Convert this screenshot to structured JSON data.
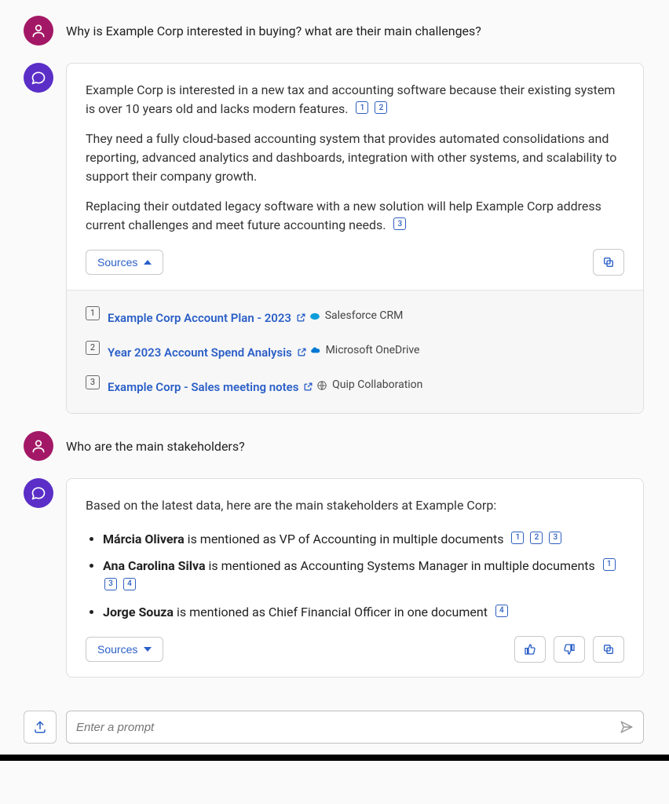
{
  "messages": [
    {
      "role": "user",
      "text": "Why is Example Corp interested in buying? what are their main challenges?"
    },
    {
      "role": "bot",
      "paragraphs": {
        "p1": "Example Corp is interested in a new tax and accounting software because their existing system is over 10 years old and lacks modern features.",
        "p2": "They need a fully cloud-based accounting system that provides automated consolidations and reporting, advanced analytics and dashboards, integration with other systems, and scalability to support their company growth.",
        "p3": "Replacing their outdated legacy software with a new solution will help Example Corp address current challenges and meet future accounting needs."
      },
      "citations": {
        "c1": "1",
        "c2": "2",
        "c3": "3"
      },
      "sources_label": "Sources",
      "sources_expanded": true,
      "sources": [
        {
          "num": "1",
          "title": "Example Corp Account Plan - 2023",
          "platform": "Salesforce CRM",
          "icon": "salesforce"
        },
        {
          "num": "2",
          "title": "Year 2023 Account Spend Analysis",
          "platform": "Microsoft OneDrive",
          "icon": "onedrive"
        },
        {
          "num": "3",
          "title": "Example Corp - Sales meeting notes",
          "platform": "Quip Collaboration",
          "icon": "quip"
        }
      ]
    },
    {
      "role": "user",
      "text": "Who are the main stakeholders?"
    },
    {
      "role": "bot",
      "intro": "Based on the latest data, here are the main stakeholders at Example Corp:",
      "stakeholders": [
        {
          "name": "Márcia Olivera",
          "rest": " is mentioned as VP of Accounting in multiple documents",
          "cites": [
            "1",
            "2",
            "3"
          ]
        },
        {
          "name": "Ana Carolina Silva",
          "rest": " is mentioned as Accounting Systems Manager in multiple documents",
          "cites": [
            "1",
            "3",
            "4"
          ]
        },
        {
          "name": "Jorge Souza",
          "rest": " is mentioned as Chief Financial Officer in one document",
          "cites": [
            "4"
          ]
        }
      ],
      "sources_label": "Sources",
      "sources_expanded": false
    }
  ],
  "input": {
    "placeholder": "Enter a prompt"
  }
}
